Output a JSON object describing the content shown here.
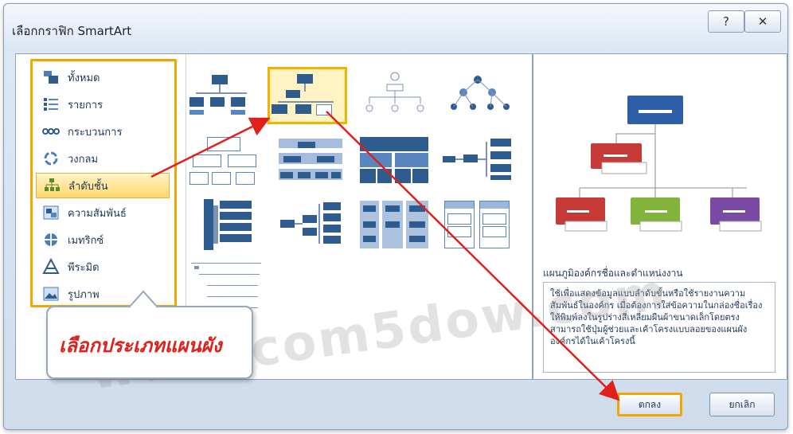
{
  "dialog": {
    "title": "เลือกกราฟิก SmartArt",
    "help_label": "?",
    "close_label": "✕"
  },
  "categories": [
    {
      "label": "ทั้งหมด",
      "icon": "all-icon"
    },
    {
      "label": "รายการ",
      "icon": "list-icon"
    },
    {
      "label": "กระบวนการ",
      "icon": "process-icon"
    },
    {
      "label": "วงกลม",
      "icon": "cycle-icon"
    },
    {
      "label": "ลำดับชั้น",
      "icon": "hierarchy-icon",
      "selected": true
    },
    {
      "label": "ความสัมพันธ์",
      "icon": "relationship-icon"
    },
    {
      "label": "เมทริกซ์",
      "icon": "matrix-icon"
    },
    {
      "label": "พีระมิด",
      "icon": "pyramid-icon"
    },
    {
      "label": "รูปภาพ",
      "icon": "picture-icon"
    }
  ],
  "preview": {
    "title": "แผนภูมิองค์กรชื่อและตำแหน่งงาน",
    "description": "ใช้เพื่อแสดงข้อมูลแบบลำดับขั้นหรือใช้รายงานความสัมพันธ์ในองค์กร เมื่อต้องการใส่ข้อความในกล่องชื่อเรื่อง ให้พิมพ์ลงในรูปร่างสี่เหลี่ยมผืนผ้าขนาดเล็กโดยตรง สามารถใช้ปุ่มผู้ช่วยและเค้าโครงแบบลอยของแผนผังองค์กรได้ในเค้าโครงนี้",
    "colors": {
      "top": "#2e5ea8",
      "middle": "#c63b37",
      "left": "#c63b37",
      "center": "#82b43c",
      "right": "#7a4aa5"
    }
  },
  "buttons": {
    "ok": "ตกลง",
    "cancel": "ยกเลิก"
  },
  "annotation": {
    "callout": "เลือกประเภทแผนผัง",
    "watermark": "www.com5dow.com",
    "highlight_color": "#f0a800",
    "arrow_color": "#e0201a"
  }
}
